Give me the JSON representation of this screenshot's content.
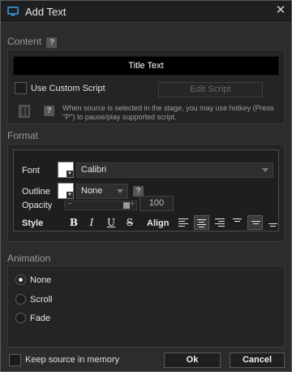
{
  "window": {
    "title": "Add Text",
    "close_glyph": "✕",
    "icon": "monitor-icon"
  },
  "content": {
    "section_label": "Content",
    "help": "?",
    "title_text": "Title Text",
    "use_custom_script_label": "Use Custom Script",
    "edit_script_label": "Edit Script",
    "hint": "When source is selected in the stage, you may use hotkey (Press \"P\") to pause/play supported script."
  },
  "format": {
    "section_label": "Format",
    "font_label": "Font",
    "font_value": "Calibri",
    "outline_label": "Outline",
    "outline_value": "None",
    "help": "?",
    "opacity_label": "Opacity",
    "opacity_value": "100",
    "opacity_fraction": 1.0,
    "minus": "−",
    "plus": "+",
    "style_label": "Style",
    "style_bold": "B",
    "style_italic": "I",
    "style_underline": "U",
    "style_strike": "S",
    "align_label": "Align"
  },
  "animation": {
    "section_label": "Animation",
    "options": [
      "None",
      "Scroll",
      "Fade"
    ],
    "selected": "None"
  },
  "footer": {
    "keep_source_label": "Keep source in memory",
    "ok_label": "Ok",
    "cancel_label": "Cancel"
  },
  "colors": {
    "accent": "#3aa0e8",
    "background": "#2c2c2c"
  }
}
